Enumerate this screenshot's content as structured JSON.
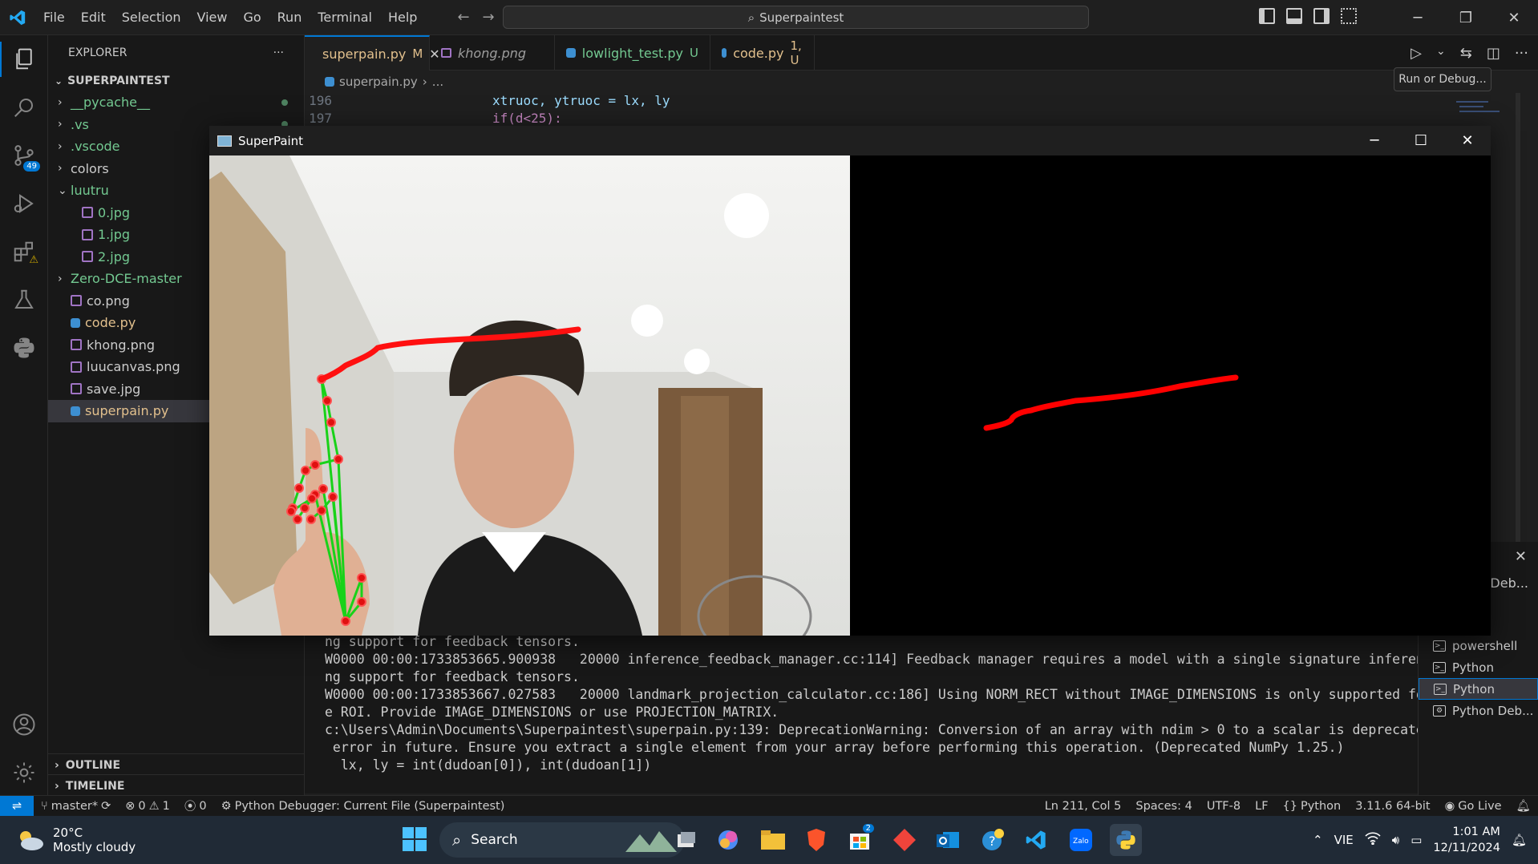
{
  "titlebar": {
    "menus": [
      "File",
      "Edit",
      "Selection",
      "View",
      "Go",
      "Run",
      "Terminal",
      "Help"
    ],
    "search_text": "Superpaintest"
  },
  "activity_badges": {
    "source_control": "49"
  },
  "sidebar": {
    "header": "EXPLORER",
    "root": "SUPERPAINTEST",
    "items": [
      {
        "label": "__pycache__",
        "type": "folder",
        "indent": 1,
        "color": "#73c991"
      },
      {
        "label": ".vs",
        "type": "folder",
        "indent": 1,
        "color": "#73c991"
      },
      {
        "label": ".vscode",
        "type": "folder",
        "indent": 1,
        "color": "#73c991"
      },
      {
        "label": "colors",
        "type": "folder",
        "indent": 1,
        "color": "#cccccc"
      },
      {
        "label": "luutru",
        "type": "folder-open",
        "indent": 1,
        "color": "#73c991"
      },
      {
        "label": "0.jpg",
        "type": "image",
        "indent": 2,
        "color": "#73c991"
      },
      {
        "label": "1.jpg",
        "type": "image",
        "indent": 2,
        "color": "#73c991"
      },
      {
        "label": "2.jpg",
        "type": "image",
        "indent": 2,
        "color": "#73c991"
      },
      {
        "label": "Zero-DCE-master",
        "type": "folder",
        "indent": 1,
        "color": "#73c991"
      },
      {
        "label": "co.png",
        "type": "image",
        "indent": 1,
        "color": "#cccccc"
      },
      {
        "label": "code.py",
        "type": "python",
        "indent": 1,
        "color": "#e2c08d"
      },
      {
        "label": "khong.png",
        "type": "image",
        "indent": 1,
        "color": "#cccccc"
      },
      {
        "label": "luucanvas.png",
        "type": "image",
        "indent": 1,
        "color": "#cccccc"
      },
      {
        "label": "save.jpg",
        "type": "image",
        "indent": 1,
        "color": "#cccccc"
      },
      {
        "label": "superpain.py",
        "type": "python",
        "indent": 1,
        "color": "#e2c08d"
      }
    ],
    "outline": "OUTLINE",
    "timeline": "TIMELINE"
  },
  "tabs": [
    {
      "label": "superpain.py",
      "suffix": "M",
      "type": "python",
      "active": true
    },
    {
      "label": "khong.png",
      "suffix": "",
      "type": "image",
      "active": false
    },
    {
      "label": "lowlight_test.py",
      "suffix": "U",
      "type": "python",
      "active": false
    },
    {
      "label": "code.py",
      "suffix": "1, U",
      "type": "python",
      "active": false
    }
  ],
  "tooltip": "Run or Debug...",
  "breadcrumb": {
    "file": "superpain.py",
    "rest": "..."
  },
  "code": [
    {
      "ln": "196",
      "text": "xtruoc, ytruoc = lx, ly"
    },
    {
      "ln": "197",
      "text": "if(d<25):"
    }
  ],
  "superpaint": {
    "title": "SuperPaint"
  },
  "terminal": {
    "lines": [
      "ng support for feedback tensors.",
      "W0000 00:00:1733853665.900938   20000 inference_feedback_manager.cc:114] Feedback manager requires a model with a single signature inference. Disabli",
      "ng support for feedback tensors.",
      "W0000 00:00:1733853667.027583   20000 landmark_projection_calculator.cc:186] Using NORM_RECT without IMAGE_DIMENSIONS is only supported for the squar",
      "e ROI. Provide IMAGE_DIMENSIONS or use PROJECTION_MATRIX.",
      "c:\\Users\\Admin\\Documents\\Superpaintest\\superpain.py:139: DeprecationWarning: Conversion of an array with ndim > 0 to a scalar is deprecated, and will",
      " error in future. Ensure you extract a single element from your array before performing this operation. (Deprecated NumPy 1.25.)",
      "  lx, ly = int(dudoan[0]), int(dudoan[1])"
    ],
    "sessions": [
      "powershell",
      "Python",
      "Python",
      "Python Deb..."
    ],
    "panel_label": "Deb..."
  },
  "statusbar": {
    "branch": "master*",
    "errors": "0",
    "warnings": "1",
    "ports": "0",
    "debug": "Python Debugger: Current File (Superpaintest)",
    "position": "Ln 211, Col 5",
    "spaces": "Spaces: 4",
    "encoding": "UTF-8",
    "eol": "LF",
    "language": "Python",
    "interpreter": "3.11.6 64-bit",
    "golive": "Go Live"
  },
  "taskbar": {
    "temperature": "20°C",
    "weather": "Mostly cloudy",
    "search": "Search",
    "lang": "VIE",
    "time": "1:01 AM",
    "date": "12/11/2024",
    "store_badge": "2"
  }
}
